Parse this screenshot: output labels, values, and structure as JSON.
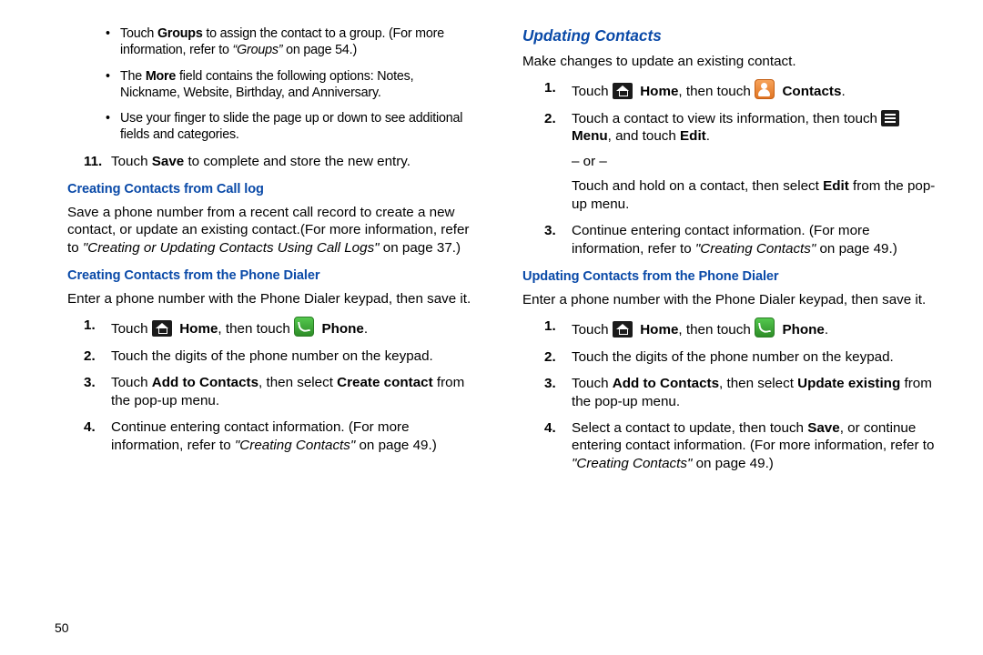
{
  "page_number": "50",
  "left": {
    "step11_prefix": "Touch ",
    "step11_bold": "Save",
    "step11_suffix": " to complete and store the new entry.",
    "h_call_log": "Creating Contacts from Call log",
    "call_log_ref_italic": "\"Creating or Updating Contacts Using Call Logs\"",
    "h_dialer": "Creating Contacts from the Phone Dialer",
    "dialer_intro": "Enter a phone number with the Phone Dialer keypad, then save it.",
    "step1_touch": "Touch ",
    "home_b": "Home",
    "then_touch": ", then touch ",
    "phone_b": "Phone",
    "step2": "Touch the digits of the phone number on the keypad.",
    "step3_a": "Touch ",
    "add_b": "Add to Contacts",
    "step3_mid": ", then select ",
    "create_b": "Create contact",
    "step3_end": " from the pop-up menu.",
    "step4_a": "Continue entering contact information. (For more information, refer to ",
    "cc_ref": "\"Creating Contacts\"",
    "step4_end": " on page 49.)"
  },
  "right": {
    "h_update": "Updating Contacts",
    "intro": "Make changes to update an existing contact.",
    "contacts_b": "Contacts",
    "step2_a": "Touch a contact to view its information, then touch ",
    "menu_b": "Menu",
    "and_touch": ", and touch ",
    "edit_b": "Edit",
    "or": "– or –",
    "step2_alt_a": "Touch and hold on a contact, then select ",
    "step2_alt_end": " from the pop-up menu.",
    "step3_a": "Continue entering contact information. (For more information, refer to ",
    "h_dialer2": "Updating Contacts from the Phone Dialer",
    "dialer2_intro": "Enter a phone number with the Phone Dialer keypad, then save it.",
    "step3b_mid": ", then select ",
    "update_b": "Update existing",
    "step3b_end": " from the pop-up menu.",
    "step4b_a": "Select a contact to update, then touch ",
    "save_b": "Save",
    "step4b_mid": ", or continue entering contact information. (For more information, refer to ",
    "step_end_49": " on page 49.)"
  }
}
